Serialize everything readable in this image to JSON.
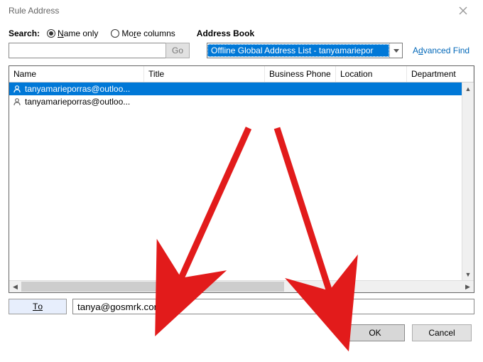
{
  "window": {
    "title": "Rule Address"
  },
  "search": {
    "label": "Search:",
    "name_only": "Name only",
    "more_columns": "More columns",
    "go": "Go",
    "value": ""
  },
  "address_book": {
    "label": "Address Book",
    "selected": "Offline Global Address List - tanyamariepor",
    "advanced_find": "Advanced Find"
  },
  "columns": {
    "name": "Name",
    "title": "Title",
    "phone": "Business Phone",
    "location": "Location",
    "dept": "Department"
  },
  "rows": [
    {
      "text": "tanyamarieporras@outloo...",
      "selected": true
    },
    {
      "text": "tanyamarieporras@outloo...",
      "selected": false
    }
  ],
  "to": {
    "button": "To",
    "value": "tanya@gosmrk.com"
  },
  "buttons": {
    "ok": "OK",
    "cancel": "Cancel"
  }
}
